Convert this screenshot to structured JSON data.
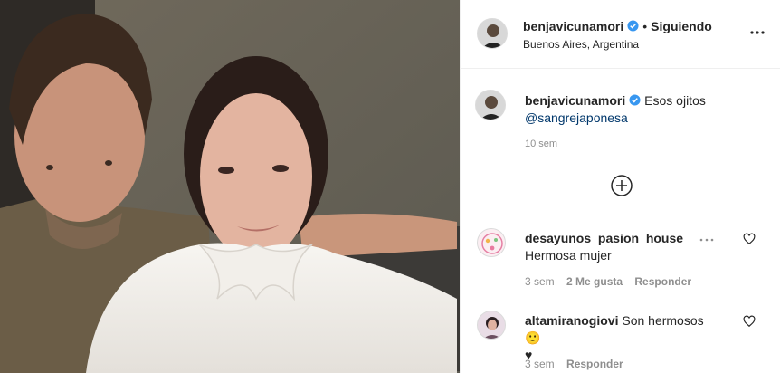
{
  "post": {
    "author": "benjavicunamori",
    "follow_status": "Siguiendo",
    "separator": "•",
    "location": "Buenos Aires, Argentina",
    "caption_text": "Esos ojitos",
    "caption_mention": "@sangrejaponesa",
    "caption_time": "10 sem"
  },
  "comments": [
    {
      "username": "desayunos_pasion_house",
      "text": "Hermosa mujer",
      "time": "3 sem",
      "likes": "2 Me gusta",
      "reply": "Responder"
    },
    {
      "username": "altamiranogiovi",
      "text": "Son hermosos🙂",
      "text2": "♥",
      "time": "3 sem",
      "reply": "Responder"
    }
  ],
  "icons": {
    "verified": "verified-badge-icon",
    "more": "more-options-icon",
    "load_more": "plus-circle-icon",
    "like": "heart-icon"
  },
  "colors": {
    "verified": "#3897f0",
    "mention": "#00376b",
    "muted": "#8e8e8e",
    "border": "#efefef"
  }
}
